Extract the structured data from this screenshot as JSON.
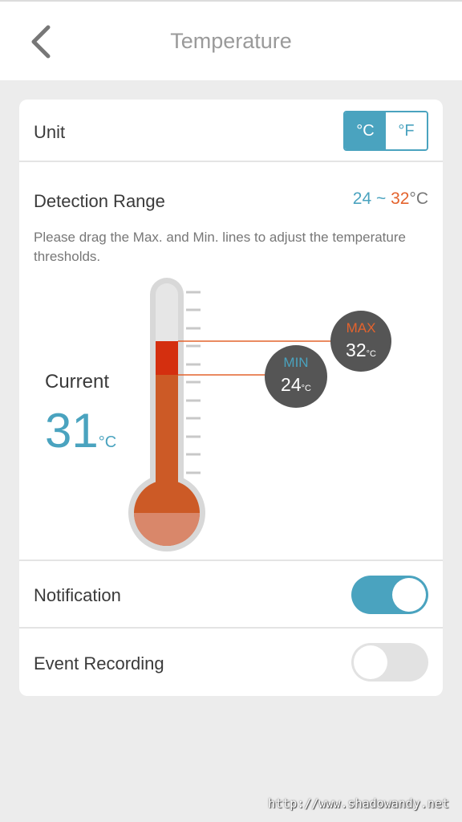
{
  "header": {
    "title": "Temperature",
    "back_icon": "chevron-left-icon"
  },
  "unit": {
    "label": "Unit",
    "options": [
      "°C",
      "°F"
    ],
    "selected": "°C"
  },
  "detection_range": {
    "label": "Detection Range",
    "min": "24",
    "separator": " ~ ",
    "max": "32",
    "unit": "°C",
    "hint": "Please drag the Max. and Min. lines to adjust the temperature thresholds."
  },
  "current": {
    "label": "Current",
    "value": "31",
    "unit": "°C"
  },
  "thresholds": {
    "max_tag": "MAX",
    "max_value": "32",
    "min_tag": "MIN",
    "min_value": "24",
    "unit": "°C"
  },
  "notification": {
    "label": "Notification",
    "enabled": true
  },
  "event_recording": {
    "label": "Event Recording",
    "enabled": false
  },
  "watermark": "http://www.shadowandy.net",
  "colors": {
    "accent": "#4aa3bf",
    "max": "#e4632d",
    "mercury": "#cc5a26",
    "alert_band": "#d42f0f"
  }
}
